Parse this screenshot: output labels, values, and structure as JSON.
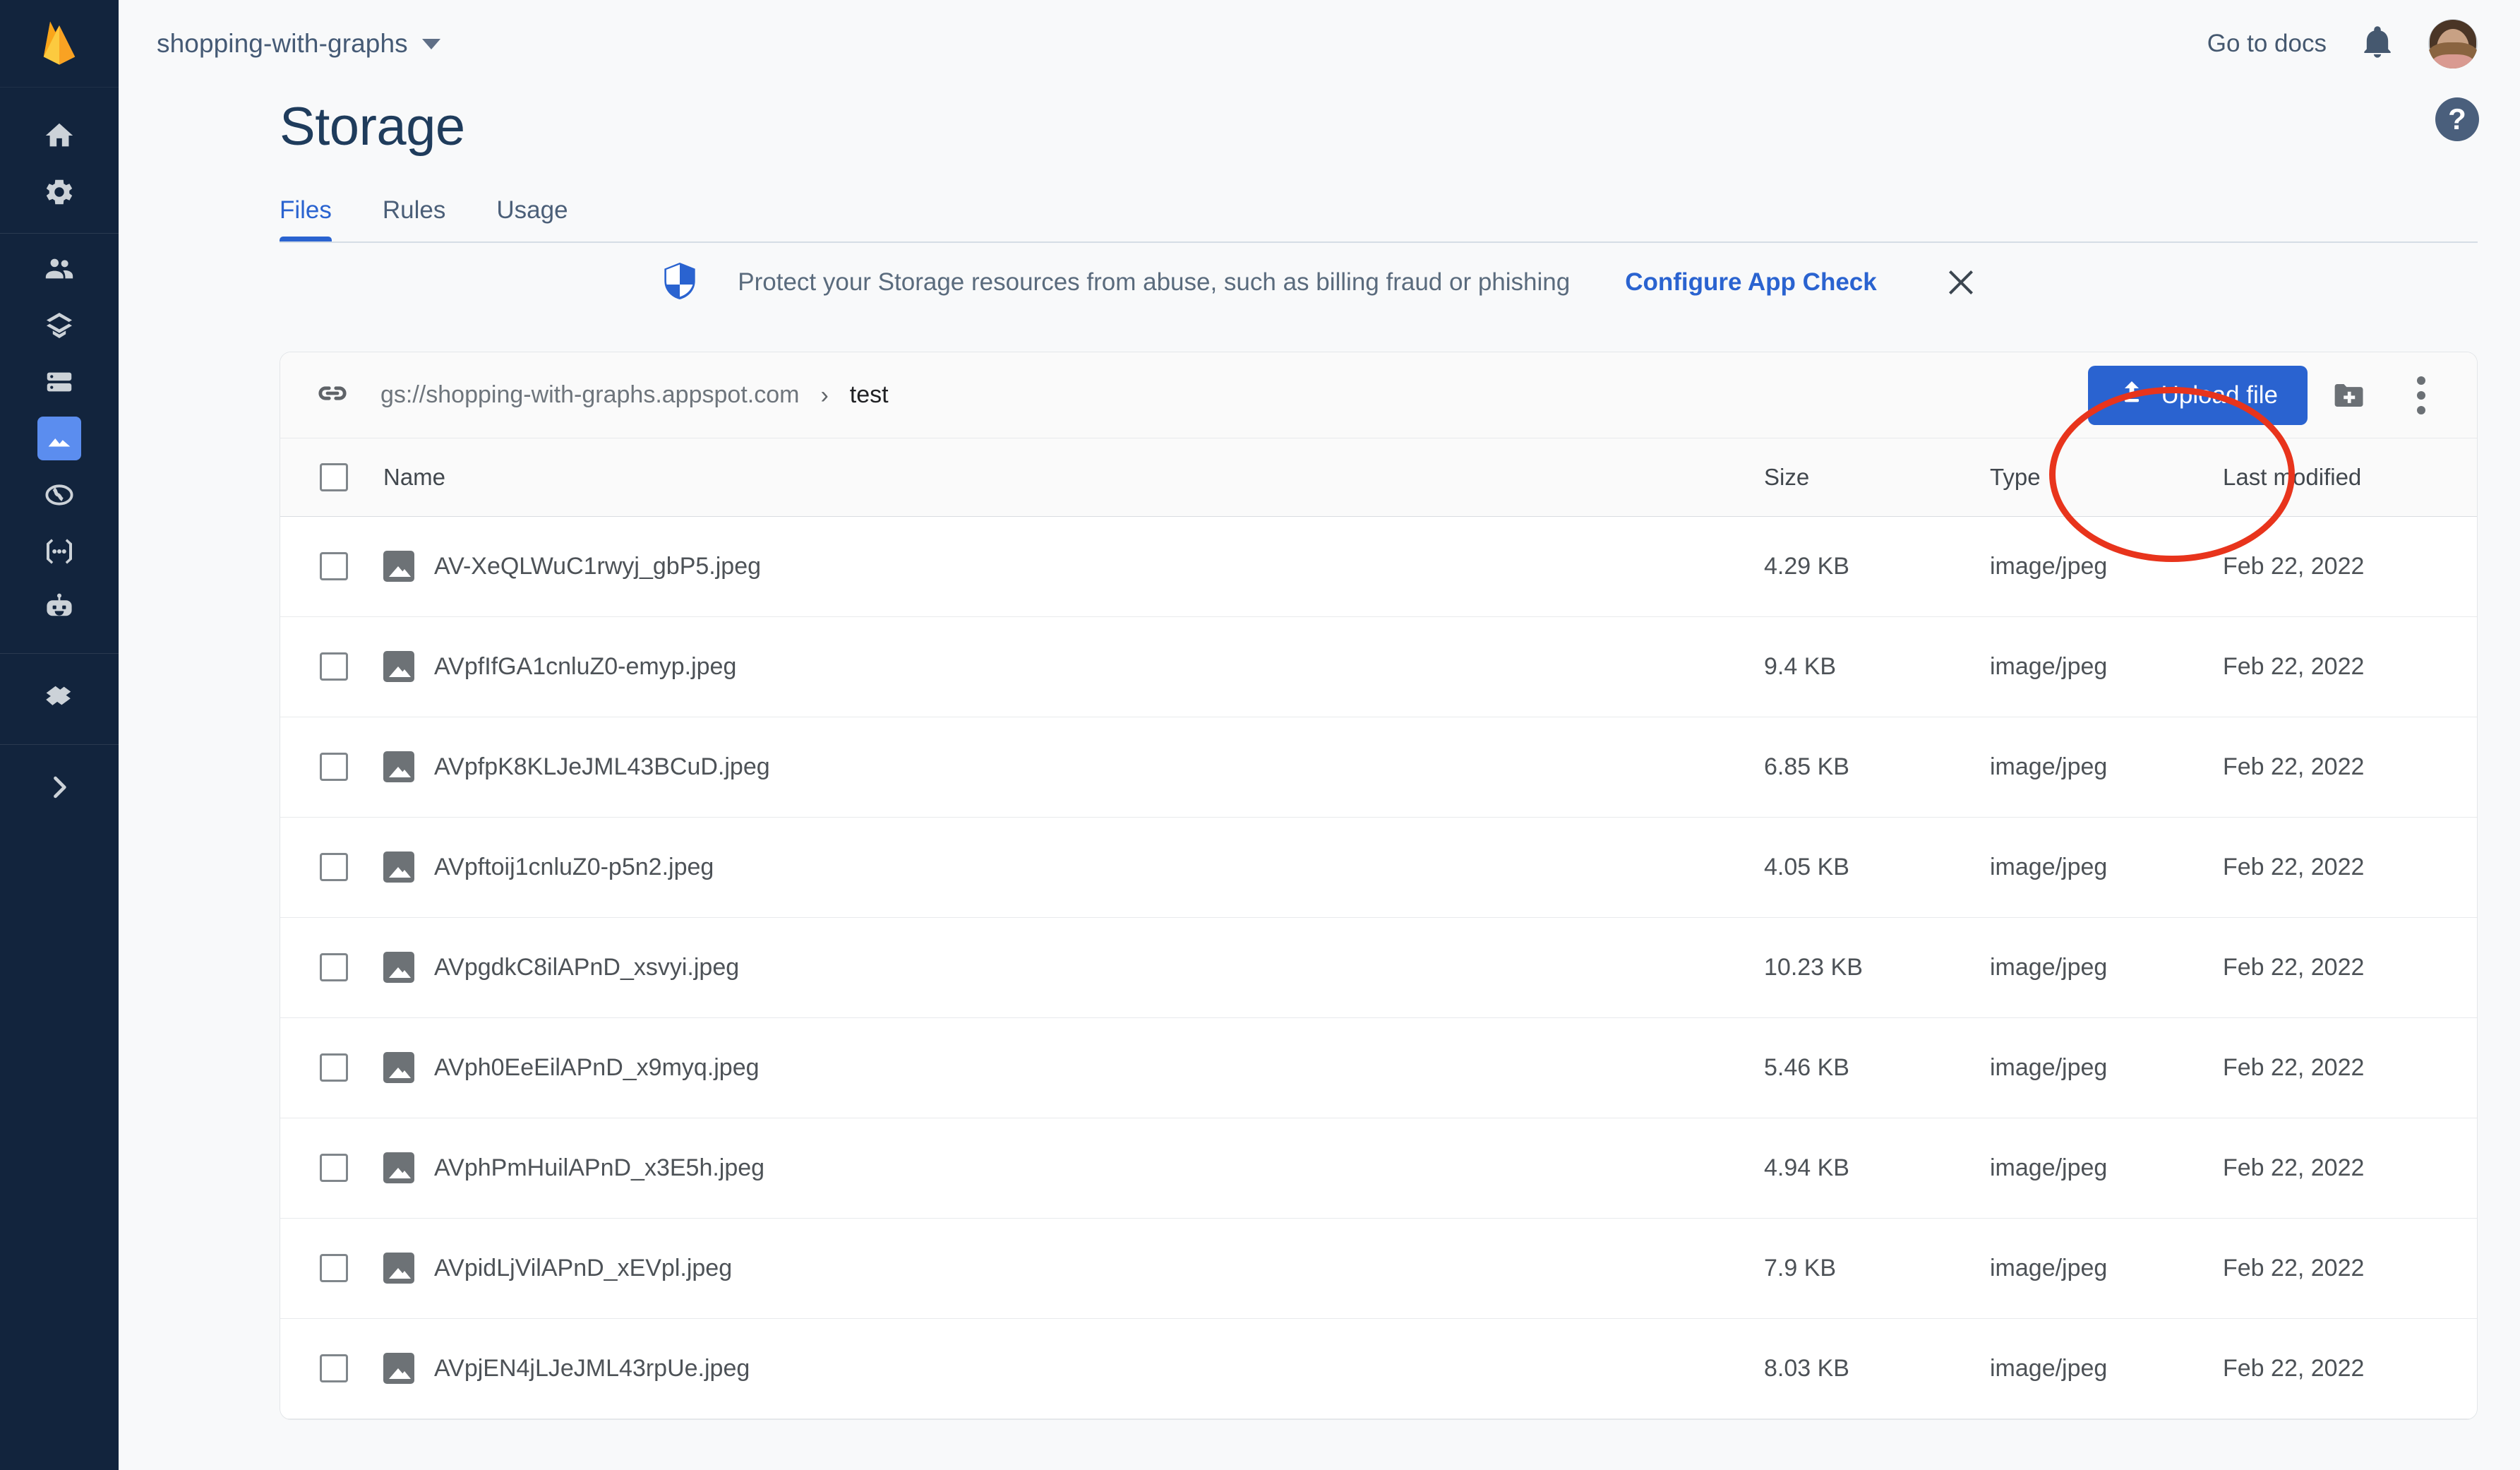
{
  "sidebar": {
    "logo": "firebase-logo",
    "items": [
      {
        "icon": "home-icon",
        "name": "project-overview"
      },
      {
        "icon": "gear-icon",
        "name": "project-settings"
      },
      {
        "icon": "people-icon",
        "name": "authentication"
      },
      {
        "icon": "layers-icon",
        "name": "firestore-database"
      },
      {
        "icon": "database-icon",
        "name": "realtime-database"
      },
      {
        "icon": "image-folder-icon",
        "name": "storage",
        "active": true
      },
      {
        "icon": "globe-icon",
        "name": "hosting"
      },
      {
        "icon": "brackets-icon",
        "name": "functions"
      },
      {
        "icon": "robot-icon",
        "name": "machine-learning"
      },
      {
        "icon": "extensions-icon",
        "name": "extensions"
      },
      {
        "icon": "chevron-right-icon",
        "name": "expand-sidebar"
      }
    ]
  },
  "topbar": {
    "project_name": "shopping-with-graphs",
    "docs_label": "Go to docs",
    "bell_icon": "notifications-bell-icon",
    "avatar_icon": "user-avatar"
  },
  "page": {
    "title": "Storage",
    "help_label": "?"
  },
  "tabs": [
    {
      "label": "Files",
      "active": true
    },
    {
      "label": "Rules",
      "active": false
    },
    {
      "label": "Usage",
      "active": false
    }
  ],
  "banner": {
    "shield_icon": "app-check-shield-icon",
    "message": "Protect your Storage resources from abuse, such as billing fraud or phishing",
    "cta_label": "Configure App Check",
    "close_icon": "close-icon"
  },
  "toolbar": {
    "link_icon": "link-icon",
    "bucket": "gs://shopping-with-graphs.appspot.com",
    "separator": "›",
    "folder": "test",
    "upload_label": "Upload file",
    "upload_icon": "upload-icon",
    "create_folder_icon": "create-folder-icon",
    "more_icon": "more-vertical-icon"
  },
  "table": {
    "headers": {
      "name": "Name",
      "size": "Size",
      "type": "Type",
      "modified": "Last modified"
    },
    "rows": [
      {
        "name": "AV-XeQLWuC1rwyj_gbP5.jpeg",
        "size": "4.29 KB",
        "type": "image/jpeg",
        "modified": "Feb 22, 2022"
      },
      {
        "name": "AVpfIfGA1cnluZ0-emyp.jpeg",
        "size": "9.4 KB",
        "type": "image/jpeg",
        "modified": "Feb 22, 2022"
      },
      {
        "name": "AVpfpK8KLJeJML43BCuD.jpeg",
        "size": "6.85 KB",
        "type": "image/jpeg",
        "modified": "Feb 22, 2022"
      },
      {
        "name": "AVpftoij1cnluZ0-p5n2.jpeg",
        "size": "4.05 KB",
        "type": "image/jpeg",
        "modified": "Feb 22, 2022"
      },
      {
        "name": "AVpgdkC8ilAPnD_xsvyi.jpeg",
        "size": "10.23 KB",
        "type": "image/jpeg",
        "modified": "Feb 22, 2022"
      },
      {
        "name": "AVph0EeEilAPnD_x9myq.jpeg",
        "size": "5.46 KB",
        "type": "image/jpeg",
        "modified": "Feb 22, 2022"
      },
      {
        "name": "AVphPmHuilAPnD_x3E5h.jpeg",
        "size": "4.94 KB",
        "type": "image/jpeg",
        "modified": "Feb 22, 2022"
      },
      {
        "name": "AVpidLjVilAPnD_xEVpl.jpeg",
        "size": "7.9 KB",
        "type": "image/jpeg",
        "modified": "Feb 22, 2022"
      },
      {
        "name": "AVpjEN4jLJeJML43rpUe.jpeg",
        "size": "8.03 KB",
        "type": "image/jpeg",
        "modified": "Feb 22, 2022"
      }
    ]
  },
  "annotation": {
    "shape": "ellipse",
    "color": "#e8341c",
    "target": "upload-file-button"
  },
  "colors": {
    "accent_blue": "#2a63d0",
    "sidebar_bg": "#12243d",
    "page_bg": "#f8f9fa",
    "title_navy": "#1f3c5c",
    "annotation_red": "#e8341c"
  }
}
